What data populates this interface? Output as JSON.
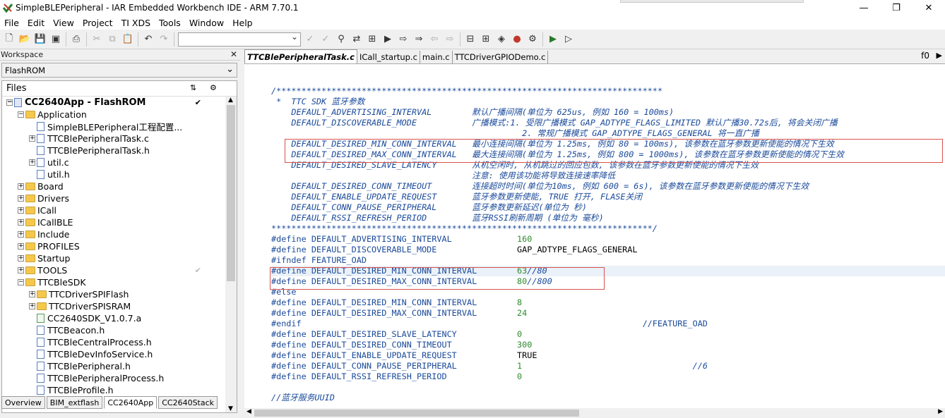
{
  "window": {
    "title": "SimpleBLEPeripheral - IAR Embedded Workbench IDE - ARM 7.70.1",
    "min": "—",
    "max": "❐",
    "close": "✕"
  },
  "menu": [
    "File",
    "Edit",
    "View",
    "Project",
    "TI XDS",
    "Tools",
    "Window",
    "Help"
  ],
  "workspace": {
    "header": "Workspace",
    "config": "FlashROM",
    "files_label": "Files",
    "tabs": [
      "Overview",
      "BIM_extflash",
      "CC2640App",
      "CC2640Stack"
    ],
    "active_tab": "CC2640App",
    "tree": [
      {
        "label": "CC2640App - FlashROM",
        "level": 0,
        "type": "project",
        "exp": "−",
        "check": "✔"
      },
      {
        "label": "Application",
        "level": 1,
        "type": "folder",
        "exp": "−"
      },
      {
        "label": "SimpleBLEPeripheral工程配置...",
        "level": 2,
        "type": "file",
        "exp": ""
      },
      {
        "label": "TTCBlePeripheralTask.c",
        "level": 2,
        "type": "file",
        "exp": "+"
      },
      {
        "label": "TTCBlePeripheralTask.h",
        "level": 2,
        "type": "file",
        "exp": ""
      },
      {
        "label": "util.c",
        "level": 2,
        "type": "file",
        "exp": "+"
      },
      {
        "label": "util.h",
        "level": 2,
        "type": "file",
        "exp": ""
      },
      {
        "label": "Board",
        "level": 1,
        "type": "folder",
        "exp": "+"
      },
      {
        "label": "Drivers",
        "level": 1,
        "type": "folder",
        "exp": "+"
      },
      {
        "label": "ICall",
        "level": 1,
        "type": "folder",
        "exp": "+"
      },
      {
        "label": "ICallBLE",
        "level": 1,
        "type": "folder",
        "exp": "+"
      },
      {
        "label": "Include",
        "level": 1,
        "type": "folder",
        "exp": "+"
      },
      {
        "label": "PROFILES",
        "level": 1,
        "type": "folder",
        "exp": "+"
      },
      {
        "label": "Startup",
        "level": 1,
        "type": "folder",
        "exp": "+"
      },
      {
        "label": "TOOLS",
        "level": 1,
        "type": "folder",
        "exp": "+",
        "check": "✔"
      },
      {
        "label": "TTCBleSDK",
        "level": 1,
        "type": "folder",
        "exp": "−"
      },
      {
        "label": "TTCDriverSPIFlash",
        "level": 2,
        "type": "folder",
        "exp": "+"
      },
      {
        "label": "TTCDriverSPISRAM",
        "level": 2,
        "type": "folder",
        "exp": "+"
      },
      {
        "label": "CC2640SDK_V1.0.7.a",
        "level": 2,
        "type": "lib",
        "exp": ""
      },
      {
        "label": "TTCBeacon.h",
        "level": 2,
        "type": "file",
        "exp": ""
      },
      {
        "label": "TTCBleCentralProcess.h",
        "level": 2,
        "type": "file",
        "exp": ""
      },
      {
        "label": "TTCBleDevInfoService.h",
        "level": 2,
        "type": "file",
        "exp": ""
      },
      {
        "label": "TTCBlePeripheral.h",
        "level": 2,
        "type": "file",
        "exp": ""
      },
      {
        "label": "TTCBlePeripheralProcess.h",
        "level": 2,
        "type": "file",
        "exp": ""
      },
      {
        "label": "TTCBleProfile.h",
        "level": 2,
        "type": "file",
        "exp": ""
      }
    ]
  },
  "editor": {
    "tabs": [
      "TTCBlePeripheralTask.c",
      "ICall_startup.c",
      "main.c",
      "TTCDriverGPIODemo.c"
    ],
    "active_tab": "TTCBlePeripheralTask.c",
    "function": "f0",
    "lines": [
      {
        "t": "",
        "c": ""
      },
      {
        "t": "",
        "c": ""
      },
      {
        "t": "/*****************************************************************************",
        "c": "cm",
        "fold": true
      },
      {
        "t": " *  TTC SDK 蓝牙参数",
        "c": "cm"
      },
      {
        "t": "    DEFAULT_ADVERTISING_INTERVAL        默认广播间隔(单位为 625us, 例如 160 = 100ms)",
        "c": "cm"
      },
      {
        "t": "    DEFAULT_DISCOVERABLE_MODE           广播模式:1. 受限广播模式 GAP_ADTYPE_FLAGS_LIMITED 默认广播30.72s后, 将会关闭广播",
        "c": "cm"
      },
      {
        "t": "                                                  2. 常规广播模式 GAP_ADTYPE_FLAGS_GENERAL 将一直广播",
        "c": "cm"
      },
      {
        "t": "    DEFAULT_DESIRED_MIN_CONN_INTERVAL   最小连接间隔(单位为 1.25ms, 例如 80 = 100ms), 该参数在蓝牙参数更新使能的情况下生效",
        "c": "cm"
      },
      {
        "t": "    DEFAULT_DESIRED_MAX_CONN_INTERVAL   最大连接间隔(单位为 1.25ms, 例如 800 = 1000ms), 该参数在蓝牙参数更新使能的情况下生效",
        "c": "cm"
      },
      {
        "t": "    DEFAULT_DESIRED_SLAVE_LATENCY       从机空闲时, 从机跳过的回应包数, 该参数在蓝牙参数更新使能的情况下生效",
        "c": "cm"
      },
      {
        "t": "                                        注意: 使用该功能将导致连接速率降低",
        "c": "cm"
      },
      {
        "t": "    DEFAULT_DESIRED_CONN_TIMEOUT        连接超时时间(单位为10ms, 例如 600 = 6s), 该参数在蓝牙参数更新使能的情况下生效",
        "c": "cm"
      },
      {
        "t": "    DEFAULT_ENABLE_UPDATE_REQUEST       蓝牙参数更新使能, TRUE 打开, FLASE关闭",
        "c": "cm"
      },
      {
        "t": "    DEFAULT_CONN_PAUSE_PERIPHERAL       蓝牙参数更新延迟(单位为 秒)",
        "c": "cm"
      },
      {
        "t": "    DEFAULT_RSSI_REFRESH_PERIOD         蓝牙RSSI刷新周期 (单位为 毫秒)",
        "c": "cm"
      },
      {
        "t": "****************************************************************************/",
        "c": "cm"
      },
      {
        "d": "#define DEFAULT_ADVERTISING_INTERVAL",
        "v": "160",
        "r": ""
      },
      {
        "d": "#define DEFAULT_DISCOVERABLE_MODE",
        "v": "",
        "r": "GAP_ADTYPE_FLAGS_GENERAL"
      },
      {
        "t": "#ifndef FEATURE_OAD",
        "c": "pp"
      },
      {
        "d": "#define DEFAULT_DESIRED_MIN_CONN_INTERVAL",
        "v": "63",
        "r": "//80",
        "hl": true
      },
      {
        "d": "#define DEFAULT_DESIRED_MAX_CONN_INTERVAL",
        "v": "80",
        "r": "//800"
      },
      {
        "t": "#else",
        "c": "pp"
      },
      {
        "d": "#define DEFAULT_DESIRED_MIN_CONN_INTERVAL",
        "v": "8",
        "r": ""
      },
      {
        "d": "#define DEFAULT_DESIRED_MAX_CONN_INTERVAL",
        "v": "24",
        "r": ""
      },
      {
        "t": "#endif                                                                    //FEATURE_OAD",
        "c": "pp"
      },
      {
        "d": "#define DEFAULT_DESIRED_SLAVE_LATENCY",
        "v": "0",
        "r": ""
      },
      {
        "d": "#define DEFAULT_DESIRED_CONN_TIMEOUT",
        "v": "300",
        "r": ""
      },
      {
        "d": "#define DEFAULT_ENABLE_UPDATE_REQUEST",
        "v": "",
        "r": "TRUE"
      },
      {
        "d": "#define DEFAULT_CONN_PAUSE_PERIPHERAL",
        "v": "1",
        "r": "",
        "tail": "//6"
      },
      {
        "d": "#define DEFAULT_RSSI_REFRESH_PERIOD",
        "v": "0",
        "r": ""
      },
      {
        "t": "",
        "c": ""
      },
      {
        "t": "//蓝牙服务UUID",
        "c": "cm"
      }
    ]
  }
}
